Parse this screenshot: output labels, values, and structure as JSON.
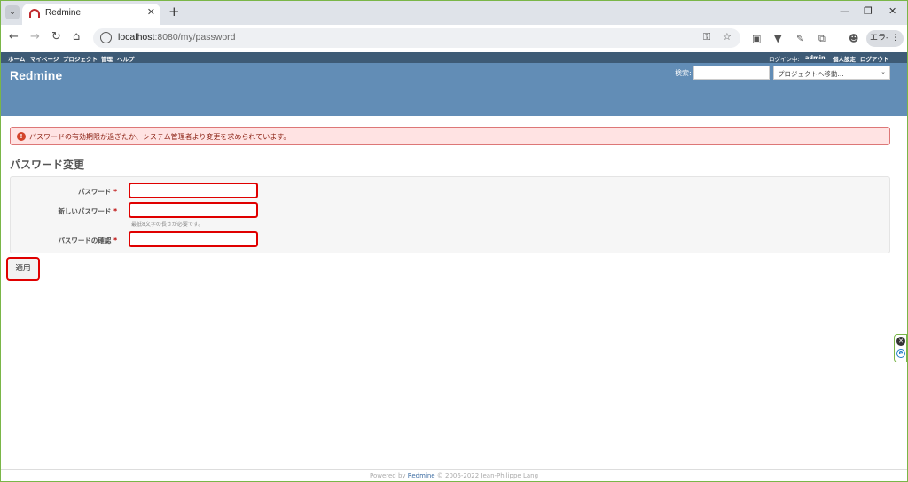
{
  "browser": {
    "tab_title": "Redmine",
    "url_host": "localhost",
    "url_rest": ":8080/my/password",
    "error_pill": "エラ-"
  },
  "top_menu": {
    "items": [
      "ホーム",
      "マイページ",
      "プロジェクト",
      "管理",
      "ヘルプ"
    ],
    "logged_in_label": "ログイン中:",
    "user": "admin",
    "my_account": "個人設定",
    "logout": "ログアウト"
  },
  "header": {
    "logo": "Redmine",
    "search_label": "検索:",
    "search_value": "",
    "jump_placeholder": "プロジェクトへ移動..."
  },
  "flash": {
    "message": "パスワードの有効期限が過ぎたか、システム管理者より変更を求められています。"
  },
  "page_title": "パスワード変更",
  "form": {
    "password_label": "パスワード",
    "new_password_label": "新しいパスワード",
    "new_password_hint": "最低8文字の長さが必要です。",
    "confirm_label": "パスワードの確認",
    "required_mark": "*",
    "submit_label": "適用"
  },
  "footer": {
    "prefix": "Powered by ",
    "link": "Redmine",
    "suffix": " © 2006-2022 Jean-Philippe Lang"
  },
  "colors": {
    "header_bg": "#628db6",
    "top_menu_bg": "#3e5b76",
    "highlight": "#e00000",
    "flash_bg": "#ffe3e3"
  }
}
